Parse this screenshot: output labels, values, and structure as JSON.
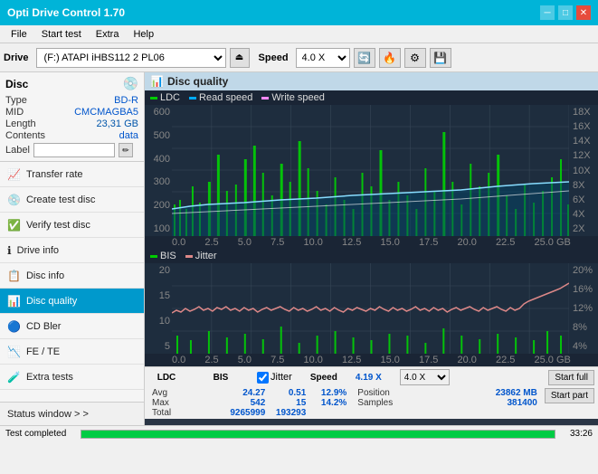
{
  "app": {
    "title": "Opti Drive Control 1.70",
    "icon": "💿"
  },
  "titlebar": {
    "title": "Opti Drive Control 1.70",
    "minimize": "─",
    "maximize": "□",
    "close": "✕"
  },
  "menubar": {
    "items": [
      "File",
      "Start test",
      "Extra",
      "Help"
    ]
  },
  "toolbar": {
    "drive_label": "Drive",
    "drive_value": "(F:) ATAPI iHBS112  2 PL06",
    "speed_label": "Speed",
    "speed_value": "4.0 X"
  },
  "disc": {
    "title": "Disc",
    "type_label": "Type",
    "type_value": "BD-R",
    "mid_label": "MID",
    "mid_value": "CMCMAGBA5",
    "length_label": "Length",
    "length_value": "23,31 GB",
    "contents_label": "Contents",
    "contents_value": "data",
    "label_label": "Label",
    "label_placeholder": ""
  },
  "nav": {
    "items": [
      {
        "id": "transfer-rate",
        "label": "Transfer rate",
        "icon": "📈"
      },
      {
        "id": "create-test-disc",
        "label": "Create test disc",
        "icon": "💿"
      },
      {
        "id": "verify-test-disc",
        "label": "Verify test disc",
        "icon": "✅"
      },
      {
        "id": "drive-info",
        "label": "Drive info",
        "icon": "ℹ"
      },
      {
        "id": "disc-info",
        "label": "Disc info",
        "icon": "📋"
      },
      {
        "id": "disc-quality",
        "label": "Disc quality",
        "icon": "📊",
        "active": true
      },
      {
        "id": "cd-bler",
        "label": "CD Bler",
        "icon": "🔵"
      },
      {
        "id": "fe-te",
        "label": "FE / TE",
        "icon": "📉"
      },
      {
        "id": "extra-tests",
        "label": "Extra tests",
        "icon": "🧪"
      }
    ],
    "status_window": "Status window > >"
  },
  "chart": {
    "title": "Disc quality",
    "icon": "📊",
    "legend_upper": [
      {
        "id": "ldc",
        "label": "LDC",
        "color": "#00cc00"
      },
      {
        "id": "read",
        "label": "Read speed",
        "color": "#88ddff"
      },
      {
        "id": "write",
        "label": "Write speed",
        "color": "#ff88ff"
      }
    ],
    "legend_lower": [
      {
        "id": "bis",
        "label": "BIS",
        "color": "#00cc00"
      },
      {
        "id": "jitter",
        "label": "Jitter",
        "color": "#dd8888"
      }
    ],
    "y_upper_left": [
      "600",
      "500",
      "400",
      "300",
      "200",
      "100"
    ],
    "y_upper_right": [
      "18X",
      "16X",
      "14X",
      "12X",
      "10X",
      "8X",
      "6X",
      "4X",
      "2X"
    ],
    "y_lower_left": [
      "20",
      "15",
      "10",
      "5"
    ],
    "y_lower_right": [
      "20%",
      "16%",
      "12%",
      "8%",
      "4%"
    ],
    "x_labels": [
      "0.0",
      "2.5",
      "5.0",
      "7.5",
      "10.0",
      "12.5",
      "15.0",
      "17.5",
      "20.0",
      "22.5",
      "25.0 GB"
    ]
  },
  "stats": {
    "ldc_label": "LDC",
    "bis_label": "BIS",
    "jitter_label": "Jitter",
    "jitter_checked": true,
    "speed_label": "Speed",
    "speed_value": "4.19 X",
    "speed_color": "#0055cc",
    "speed_select": "4.0 X",
    "avg_label": "Avg",
    "avg_ldc": "24.27",
    "avg_bis": "0.51",
    "avg_jitter": "12.9%",
    "max_label": "Max",
    "max_ldc": "542",
    "max_bis": "15",
    "max_jitter": "14.2%",
    "position_label": "Position",
    "position_value": "23862 MB",
    "total_label": "Total",
    "total_ldc": "9265999",
    "total_bis": "193293",
    "samples_label": "Samples",
    "samples_value": "381400",
    "start_full": "Start full",
    "start_part": "Start part"
  },
  "statusbar": {
    "message": "Test completed",
    "progress": 100,
    "time": "33:26"
  }
}
